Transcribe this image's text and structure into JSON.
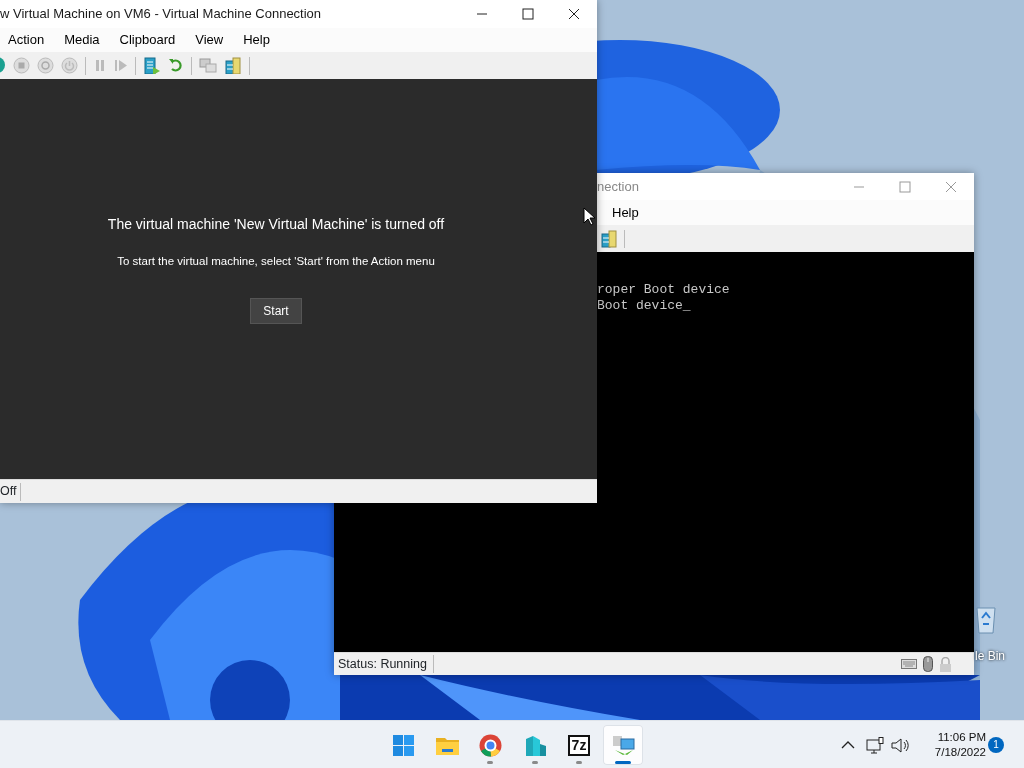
{
  "back_window": {
    "title": "nection",
    "menu": [
      "Help"
    ],
    "console_lines": [
      "roper Boot device",
      "Boot device_"
    ],
    "status": "Status: Running"
  },
  "front_window": {
    "title": "w Virtual Machine on VM6 - Virtual Machine Connection",
    "menu": [
      "Action",
      "Media",
      "Clipboard",
      "View",
      "Help"
    ],
    "heading": "The virtual machine 'New Virtual Machine' is turned off",
    "detail": "To start the virtual machine, select 'Start' from the Action menu",
    "start_button": "Start",
    "status": "Off"
  },
  "desktop": {
    "recycle_bin_label": "le Bin"
  },
  "taskbar": {
    "apps": [
      {
        "kind": "start",
        "running": false,
        "selected": false
      },
      {
        "kind": "folder",
        "running": false,
        "selected": false
      },
      {
        "kind": "browser",
        "running": true,
        "selected": false
      },
      {
        "kind": "buildings",
        "running": true,
        "selected": false
      },
      {
        "kind": "archive",
        "label": "7z",
        "running": true,
        "selected": false
      },
      {
        "kind": "hyperv",
        "running": true,
        "selected": true
      }
    ],
    "time": "11:06 PM",
    "date": "7/18/2022",
    "notifications": "1"
  }
}
